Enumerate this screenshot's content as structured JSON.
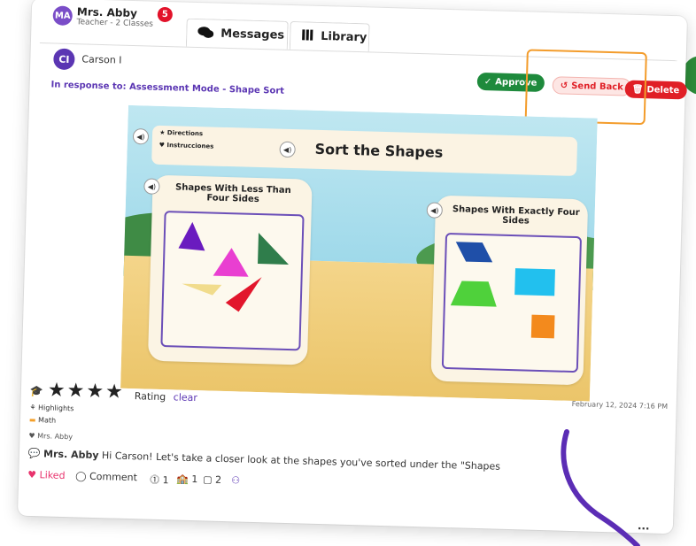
{
  "header": {
    "user_initials": "MA",
    "user_name": "Mrs. Abby",
    "user_subtitle": "Teacher - 2 Classes",
    "notification_count": "5",
    "tabs": [
      {
        "label": "Messages",
        "icon": "chat-bubbles-icon"
      },
      {
        "label": "Library",
        "icon": "books-icon"
      }
    ]
  },
  "student": {
    "initials": "CI",
    "name": "Carson I"
  },
  "response": {
    "prefix": "In response to:",
    "assignment": "Assessment Mode - Shape Sort"
  },
  "actions": {
    "approve": "Approve",
    "send_back": "Send Back",
    "delete": "Delete"
  },
  "game": {
    "directions": "Directions",
    "instrucciones": "Instrucciones",
    "title": "Sort the Shapes",
    "left_panel_title": "Shapes With Less Than Four Sides",
    "right_panel_title": "Shapes With Exactly Four Sides"
  },
  "rating": {
    "stars": 4,
    "label": "Rating",
    "clear": "clear"
  },
  "timestamp": "February 12, 2024 7:16 PM",
  "tags": {
    "highlights": "Highlights",
    "subject": "Math",
    "liked_by": "Mrs. Abby"
  },
  "comment": {
    "author": "Mrs. Abby",
    "text": "Hi Carson! Let's take a closer look at the shapes you've sorted under the \"Shapes"
  },
  "footer": {
    "liked": "Liked",
    "comment": "Comment",
    "views": "1",
    "classes": "1",
    "pages": "2",
    "more": "..."
  },
  "colors": {
    "brand_purple": "#5b36b3",
    "approve_green": "#1e8a3c",
    "delete_red": "#e01f26",
    "highlight_orange": "#f39c2b",
    "heart_pink": "#e8336d"
  }
}
